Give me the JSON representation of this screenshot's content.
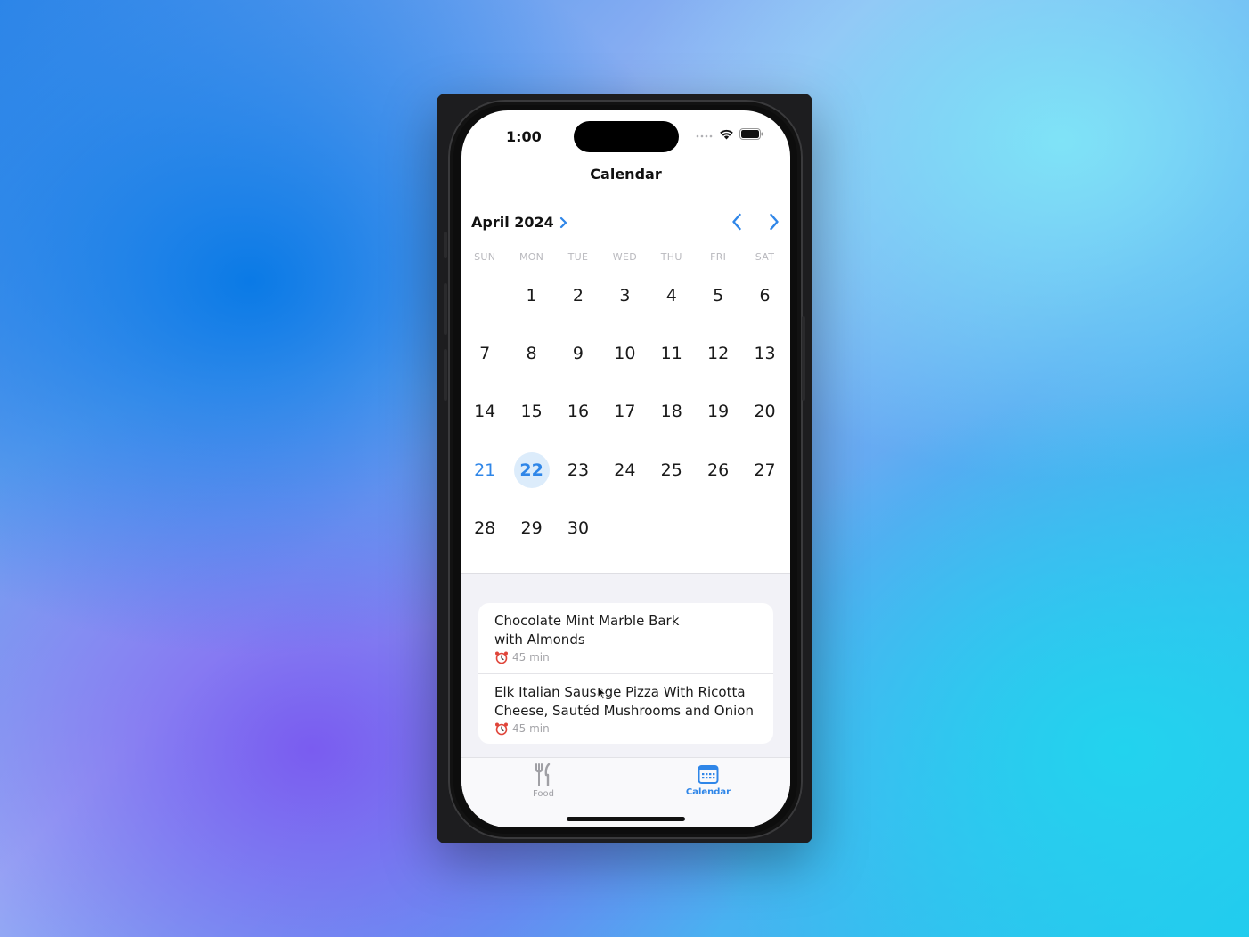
{
  "status_bar": {
    "time": "1:00"
  },
  "nav": {
    "title": "Calendar"
  },
  "calendar": {
    "month_label": "April 2024",
    "weekdays": [
      "SUN",
      "MON",
      "TUE",
      "WED",
      "THU",
      "FRI",
      "SAT"
    ],
    "weeks": [
      [
        "",
        "1",
        "2",
        "3",
        "4",
        "5",
        "6"
      ],
      [
        "7",
        "8",
        "9",
        "10",
        "11",
        "12",
        "13"
      ],
      [
        "14",
        "15",
        "16",
        "17",
        "18",
        "19",
        "20"
      ],
      [
        "21",
        "22",
        "23",
        "24",
        "25",
        "26",
        "27"
      ],
      [
        "28",
        "29",
        "30",
        "",
        "",
        "",
        ""
      ]
    ],
    "today": "21",
    "selected": "22"
  },
  "recipes": [
    {
      "title_line1": "Chocolate Mint Marble Bark",
      "title_line2": "with Almonds",
      "time": "45 min"
    },
    {
      "title_line1": "Elk Italian Sausage Pizza With Ricotta",
      "title_line2": "Cheese, Sautéd Mushrooms and Onion",
      "time": "45 min"
    }
  ],
  "tabs": {
    "food": {
      "label": "Food",
      "icon": "fork-knife-icon"
    },
    "calendar": {
      "label": "Calendar",
      "icon": "calendar-icon"
    }
  },
  "colors": {
    "accent": "#2f86e8",
    "selected_bg": "#dcecfb",
    "inactive_tab": "#a0a0a5"
  }
}
